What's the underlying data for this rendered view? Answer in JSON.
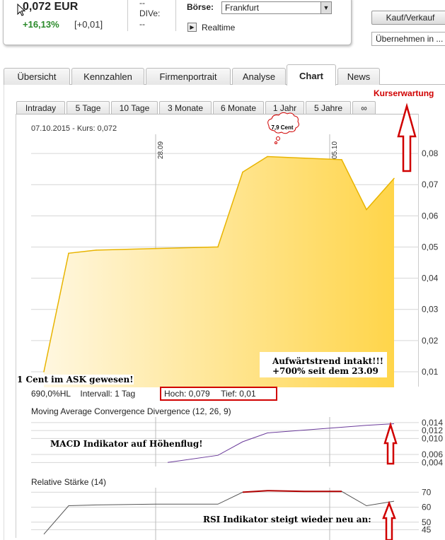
{
  "quote": {
    "price": "0,072 EUR",
    "change_pct": "+16,13%",
    "change_abs": "[+0,01]",
    "dive_top": "--",
    "dive_label": "DIVe:",
    "dive_value": "--",
    "boerse_label": "Börse:",
    "boerse_value": "Frankfurt",
    "realtime_label": "Realtime",
    "kauf_label": "Kauf/Verkauf",
    "uebernehmen_label": "Übernehmen in ..."
  },
  "tabs": [
    {
      "label": "Übersicht"
    },
    {
      "label": "Kennzahlen"
    },
    {
      "label": "Firmenportrait"
    },
    {
      "label": "Analyse"
    },
    {
      "label": "Chart"
    },
    {
      "label": "News"
    }
  ],
  "kurserwartung": "Kurserwartung",
  "subtabs": [
    {
      "label": "Intraday"
    },
    {
      "label": "5 Tage"
    },
    {
      "label": "10 Tage"
    },
    {
      "label": "3 Monate"
    },
    {
      "label": "6 Monate"
    },
    {
      "label": "1 Jahr"
    },
    {
      "label": "5 Jahre"
    },
    {
      "label": "∞"
    }
  ],
  "info_line": "07.10.2015  -  Kurs: 0,072",
  "annotations": {
    "cloud": "7,9 Cent",
    "trend_line1": "Aufwärtstrend intakt!!!",
    "trend_line2": "+700% seit dem 23.09",
    "ask": "1 Cent im ASK gewesen!",
    "macd_note": "MACD Indikator auf Höhenflug!",
    "rsi_note": "RSI Indikator steigt wieder neu an:"
  },
  "stats": {
    "hl": "690,0%HL",
    "intervall": "Intervall: 1 Tag",
    "hoch": "Hoch:  0,079",
    "tief": "Tief:   0,01"
  },
  "colors": {
    "area_light": "#fff7e0",
    "area_dark": "#ffd54a",
    "line_price": "#e8b400",
    "macd_line": "#6a3a9a",
    "rsi_line": "#555555",
    "rsi_highlight": "#b00000",
    "annotation_red": "#d00000"
  },
  "chart_data": [
    {
      "type": "area",
      "title": "",
      "x": [
        "23.09",
        "24.09",
        "25.09",
        "28.09",
        "29.09",
        "30.09",
        "01.10",
        "02.10",
        "05.10",
        "06.10",
        "07.10"
      ],
      "x_ticks": [
        "28.09",
        "05.10"
      ],
      "values": [
        0.01,
        0.048,
        0.049,
        0.0495,
        0.05,
        0.074,
        0.079,
        0.0785,
        0.078,
        0.062,
        0.072
      ],
      "ylim": [
        0.005,
        0.085
      ],
      "yticks": [
        0.01,
        0.02,
        0.03,
        0.04,
        0.05,
        0.06,
        0.07,
        0.08
      ],
      "ytick_labels": [
        "0,01",
        "0,02",
        "0,03",
        "0,04",
        "0,05",
        "0,06",
        "0,07",
        "0,08"
      ],
      "grid": true
    },
    {
      "type": "line",
      "title": "Moving Average Convergence Divergence (12, 26, 9)",
      "x": [
        "29.09",
        "30.09",
        "01.10",
        "02.10",
        "05.10",
        "06.10",
        "07.10"
      ],
      "values": [
        0.004,
        0.0058,
        0.0092,
        0.0114,
        0.0126,
        0.0133,
        0.0137
      ],
      "ylim": [
        0.003,
        0.0145
      ],
      "ytick_labels": [
        "0,014",
        "0,012",
        "0,010",
        "0,006",
        "0,004"
      ],
      "yticks": [
        0.014,
        0.012,
        0.01,
        0.006,
        0.004
      ]
    },
    {
      "type": "line",
      "title": "Relative Stärke (14)",
      "x": [
        "23.09",
        "24.09",
        "25.09",
        "28.09",
        "29.09",
        "30.09",
        "01.10",
        "02.10",
        "05.10",
        "06.10",
        "07.10"
      ],
      "values": [
        42,
        61,
        61.5,
        62,
        62,
        70,
        71,
        70.5,
        70.5,
        61,
        64
      ],
      "ylim": [
        40,
        73
      ],
      "ytick_labels": [
        "70",
        "60",
        "50",
        "45"
      ],
      "yticks": [
        70,
        60,
        50,
        45
      ]
    }
  ]
}
